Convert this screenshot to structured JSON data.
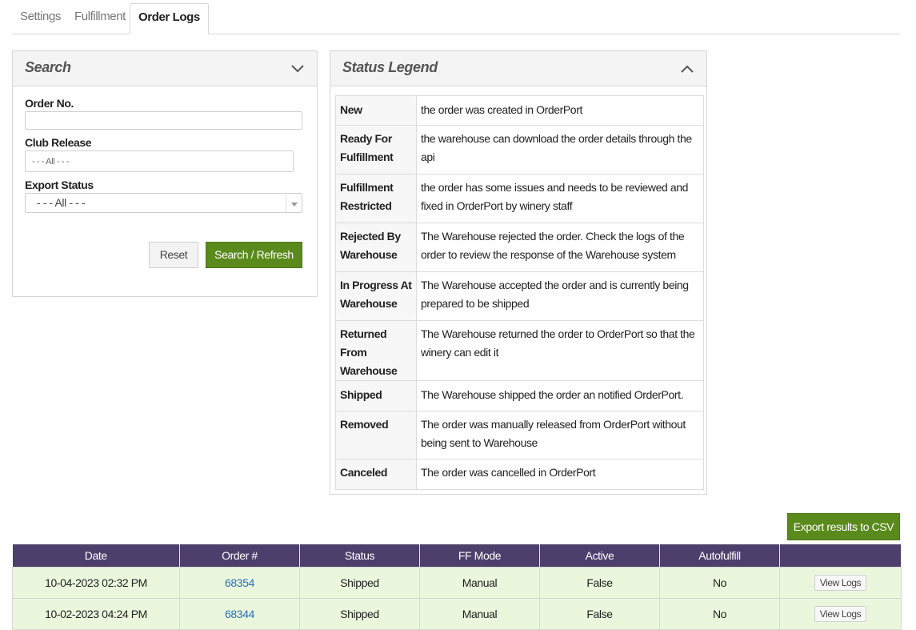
{
  "tabs": [
    {
      "label": "Settings"
    },
    {
      "label": "Fulfillment"
    },
    {
      "label": "Order Logs"
    }
  ],
  "search": {
    "title": "Search",
    "order_no_label": "Order No.",
    "order_no_value": "",
    "club_release_label": "Club Release",
    "club_release_placeholder": "- - - All - - -",
    "export_status_label": "Export Status",
    "export_status_value": "- - - All - - -",
    "reset_label": "Reset",
    "search_label": "Search / Refresh"
  },
  "legend": {
    "title": "Status Legend",
    "rows": [
      {
        "status": "New",
        "desc": "the order was created in OrderPort"
      },
      {
        "status": "Ready For Fulfillment",
        "desc": "the warehouse can download the order details through the api"
      },
      {
        "status": "Fulfillment Restricted",
        "desc": "the order has some issues and needs to be reviewed and fixed in OrderPort by winery staff"
      },
      {
        "status": "Rejected By Warehouse",
        "desc": "The Warehouse rejected the order. Check the logs of the order to review the response of the Warehouse system"
      },
      {
        "status": "In Progress At Warehouse",
        "desc": "The Warehouse accepted the order and is currently being prepared to be shipped"
      },
      {
        "status": "Returned From Warehouse",
        "desc": "The Warehouse returned the order to OrderPort so that the winery can edit it"
      },
      {
        "status": "Shipped",
        "desc": "The Warehouse shipped the order an notified OrderPort."
      },
      {
        "status": "Removed",
        "desc": "The order was manually released from OrderPort without being sent to Warehouse"
      },
      {
        "status": "Canceled",
        "desc": "The order was cancelled in OrderPort"
      }
    ]
  },
  "export_label": "Export results to CSV",
  "results": {
    "headers": [
      "Date",
      "Order #",
      "Status",
      "FF Mode",
      "Active",
      "Autofulfill",
      ""
    ],
    "rows": [
      {
        "date": "10-04-2023 02:32 PM",
        "order": "68354",
        "status": "Shipped",
        "ff_mode": "Manual",
        "active": "False",
        "autofulfill": "No",
        "action": "View Logs"
      },
      {
        "date": "10-02-2023 04:24 PM",
        "order": "68344",
        "status": "Shipped",
        "ff_mode": "Manual",
        "active": "False",
        "autofulfill": "No",
        "action": "View Logs"
      }
    ]
  }
}
